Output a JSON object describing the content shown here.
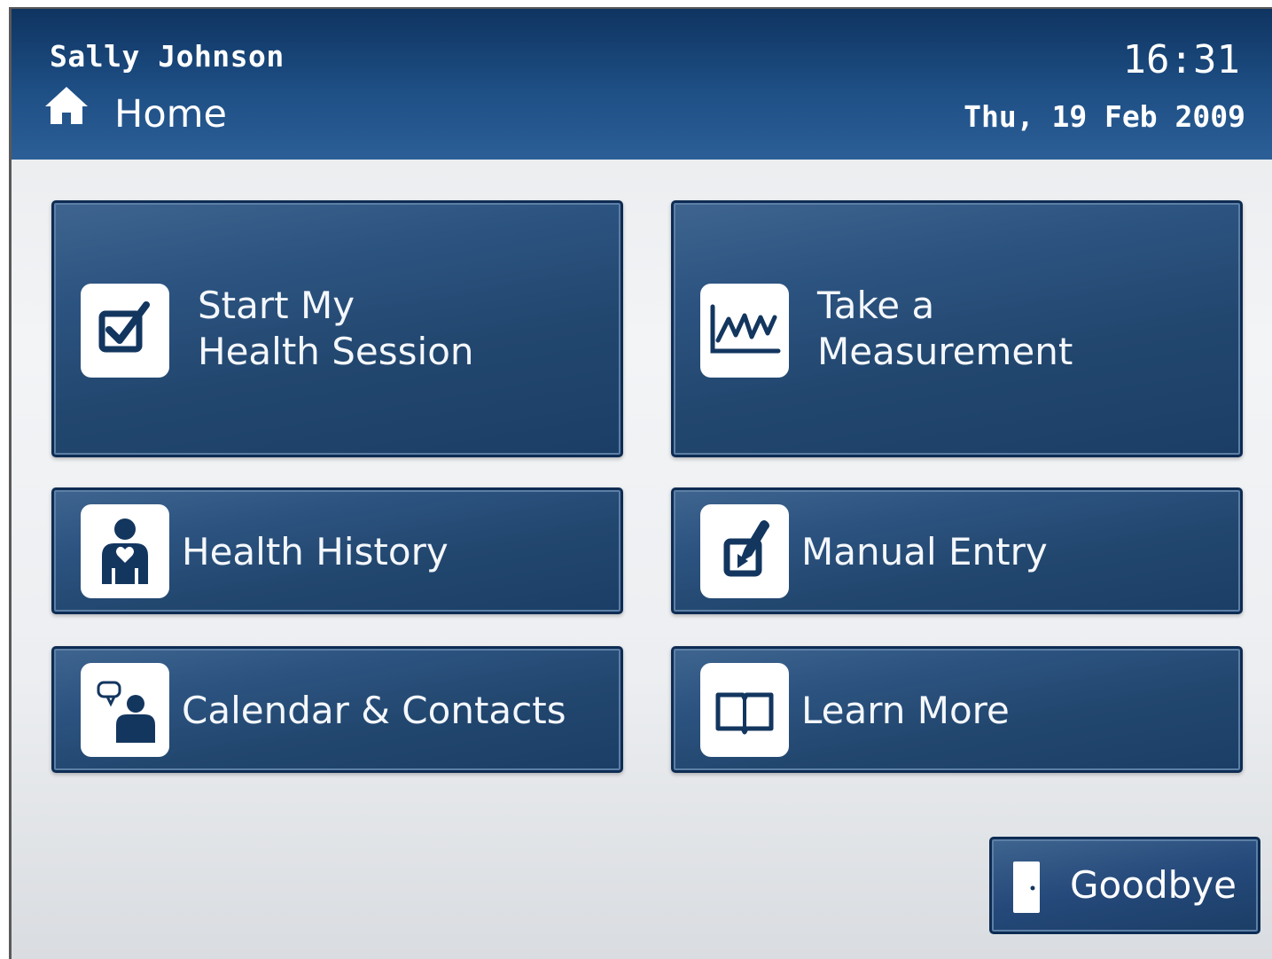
{
  "header": {
    "user_name": "Sally Johnson",
    "page_title": "Home",
    "time": "16:31",
    "date": "Thu, 19 Feb 2009"
  },
  "tiles": [
    {
      "line1": "Start My",
      "line2": "Health Session",
      "icon": "checkbox-icon"
    },
    {
      "line1": "Take a",
      "line2": "Measurement",
      "icon": "chart-line-icon"
    },
    {
      "label": "Health History",
      "icon": "person-heart-icon"
    },
    {
      "label": "Manual Entry",
      "icon": "pen-edit-icon"
    },
    {
      "label": "Calendar & Contacts",
      "icon": "person-chat-icon"
    },
    {
      "label": "Learn More",
      "icon": "book-icon"
    }
  ],
  "goodbye": {
    "label": "Goodbye",
    "icon": "door-icon"
  },
  "colors": {
    "header_bg": "#1e4f85",
    "tile_bg": "#22476f",
    "icon_fg": "#13365f"
  }
}
